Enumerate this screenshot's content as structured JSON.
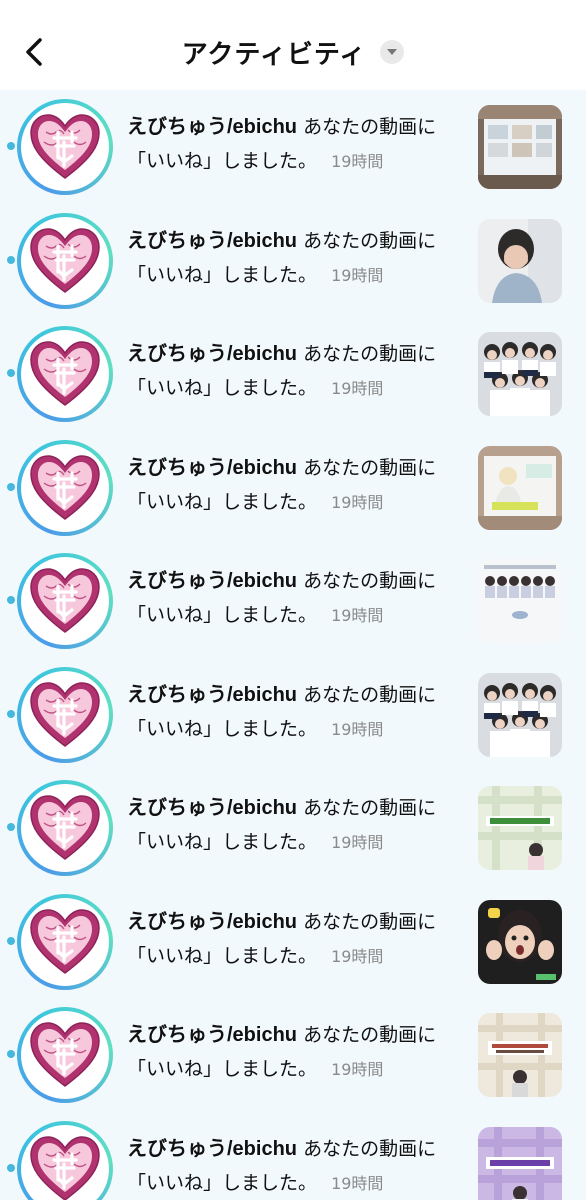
{
  "header": {
    "title": "アクティビティ",
    "back_icon": "chevron-left-icon",
    "dropdown_icon": "caret-down-icon"
  },
  "notifications": [
    {
      "user": "えびちゅう/ebichu",
      "message_line1": "あなたの動画に",
      "message_line2": "「いいね」しました。",
      "time": "19時間",
      "thumb_style": "meeting"
    },
    {
      "user": "えびちゅう/ebichu",
      "message_line1": "あなたの動画に",
      "message_line2": "「いいね」しました。",
      "time": "19時間",
      "thumb_style": "portrait"
    },
    {
      "user": "えびちゅう/ebichu",
      "message_line1": "あなたの動画に",
      "message_line2": "「いいね」しました。",
      "time": "19時間",
      "thumb_style": "group"
    },
    {
      "user": "えびちゅう/ebichu",
      "message_line1": "あなたの動画に",
      "message_line2": "「いいね」しました。",
      "time": "19時間",
      "thumb_style": "stage"
    },
    {
      "user": "えびちゅう/ebichu",
      "message_line1": "あなたの動画に",
      "message_line2": "「いいね」しました。",
      "time": "19時間",
      "thumb_style": "lineup"
    },
    {
      "user": "えびちゅう/ebichu",
      "message_line1": "あなたの動画に",
      "message_line2": "「いいね」しました。",
      "time": "19時間",
      "thumb_style": "group"
    },
    {
      "user": "えびちゅう/ebichu",
      "message_line1": "あなたの動画に",
      "message_line2": "「いいね」しました。",
      "time": "19時間",
      "thumb_style": "green-plaid"
    },
    {
      "user": "えびちゅう/ebichu",
      "message_line1": "あなたの動画に",
      "message_line2": "「いいね」しました。",
      "time": "19時間",
      "thumb_style": "surprised"
    },
    {
      "user": "えびちゅう/ebichu",
      "message_line1": "あなたの動画に",
      "message_line2": "「いいね」しました。",
      "time": "19時間",
      "thumb_style": "beige-plaid"
    },
    {
      "user": "えびちゅう/ebichu",
      "message_line1": "あなたの動画に",
      "message_line2": "「いいね」しました。",
      "time": "19時間",
      "thumb_style": "purple-plaid"
    }
  ],
  "colors": {
    "list_background": "#f2f9fd",
    "unread_dot": "#46b8de",
    "avatar_ring_start": "#4c9be8",
    "avatar_ring_end": "#5fe0c0",
    "heart_logo": "#b0336f",
    "time_text": "#8a8a8a"
  }
}
